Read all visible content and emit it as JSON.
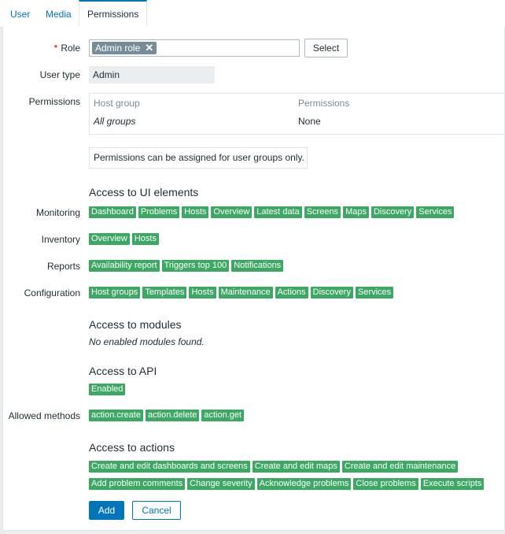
{
  "tabs": [
    {
      "label": "User"
    },
    {
      "label": "Media"
    },
    {
      "label": "Permissions"
    }
  ],
  "form": {
    "role": {
      "label": "Role",
      "required_mark": "*",
      "value": "Admin role",
      "select_label": "Select"
    },
    "user_type": {
      "label": "User type",
      "value": "Admin"
    },
    "permissions": {
      "label": "Permissions",
      "columns": [
        "Host group",
        "Permissions"
      ],
      "row": {
        "host_group": "All groups",
        "permission": "None"
      },
      "note": "Permissions can be assigned for user groups only."
    },
    "ui_elements": {
      "heading": "Access to UI elements",
      "groups": [
        {
          "label": "Monitoring",
          "items": [
            "Dashboard",
            "Problems",
            "Hosts",
            "Overview",
            "Latest data",
            "Screens",
            "Maps",
            "Discovery",
            "Services"
          ]
        },
        {
          "label": "Inventory",
          "items": [
            "Overview",
            "Hosts"
          ]
        },
        {
          "label": "Reports",
          "items": [
            "Availability report",
            "Triggers top 100",
            "Notifications"
          ]
        },
        {
          "label": "Configuration",
          "items": [
            "Host groups",
            "Templates",
            "Hosts",
            "Maintenance",
            "Actions",
            "Discovery",
            "Services"
          ]
        }
      ]
    },
    "modules": {
      "heading": "Access to modules",
      "note": "No enabled modules found."
    },
    "api": {
      "heading": "Access to API",
      "status": "Enabled",
      "methods_label": "Allowed methods",
      "methods": [
        "action.create",
        "action.delete",
        "action.get"
      ]
    },
    "actions": {
      "heading": "Access to actions",
      "row1": [
        "Create and edit dashboards and screens",
        "Create and edit maps",
        "Create and edit maintenance"
      ],
      "row2": [
        "Add problem comments",
        "Change severity",
        "Acknowledge problems",
        "Close problems",
        "Execute scripts"
      ]
    },
    "buttons": {
      "add": "Add",
      "cancel": "Cancel"
    }
  },
  "colors": {
    "accent": "#0275b8",
    "tag_green": "#3da863",
    "required": "#d40000"
  }
}
